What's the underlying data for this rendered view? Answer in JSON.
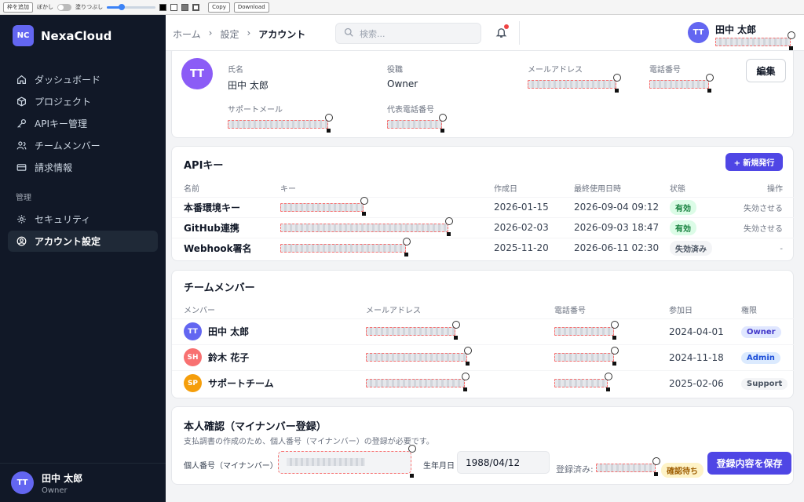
{
  "toolbar": {
    "add_frame": "枠を追加",
    "blur": "ぼかし",
    "fill": "塗りつぶし",
    "copy": "Copy",
    "download": "Download",
    "slider_level": 0.3
  },
  "brand": {
    "logo": "NC",
    "name": "NexaCloud"
  },
  "nav": {
    "items": [
      {
        "label": "ダッシュボード",
        "icon": "home-icon"
      },
      {
        "label": "プロジェクト",
        "icon": "cube-icon"
      },
      {
        "label": "APIキー管理",
        "icon": "key-icon"
      },
      {
        "label": "チームメンバー",
        "icon": "users-icon"
      },
      {
        "label": "請求情報",
        "icon": "card-icon"
      }
    ],
    "section": "管理",
    "admin_items": [
      {
        "label": "セキュリティ",
        "icon": "gear-icon"
      },
      {
        "label": "アカウント設定",
        "icon": "user-circle-icon"
      }
    ]
  },
  "user": {
    "initials": "TT",
    "name": "田中 太郎",
    "role": "Owner"
  },
  "header": {
    "breadcrumbs": [
      "ホーム",
      "設定",
      "アカウント"
    ],
    "search_placeholder": "検索..."
  },
  "profile": {
    "name_label": "氏名",
    "name": "田中 太郎",
    "role_label": "役職",
    "role": "Owner",
    "email_label": "メールアドレス",
    "phone_label": "電話番号",
    "support_email_label": "サポートメール",
    "rep_phone_label": "代表電話番号",
    "edit": "編集"
  },
  "api": {
    "title": "APIキー",
    "new_button": "+ 新規発行",
    "headers": [
      "名前",
      "キー",
      "作成日",
      "最終使用日時",
      "状態",
      "操作"
    ],
    "rows": [
      {
        "name": "本番環境キー",
        "created": "2026-01-15",
        "last_used": "2026-09-04 09:12",
        "status": "有効",
        "action": "失効させる"
      },
      {
        "name": "GitHub連携",
        "created": "2026-02-03",
        "last_used": "2026-09-03 18:47",
        "status": "有効",
        "action": "失効させる"
      },
      {
        "name": "Webhook署名",
        "created": "2025-11-20",
        "last_used": "2026-06-11 02:30",
        "status": "失効済み",
        "action": "-"
      }
    ]
  },
  "team": {
    "title": "チームメンバー",
    "headers": [
      "メンバー",
      "メールアドレス",
      "電話番号",
      "参加日",
      "権限"
    ],
    "rows": [
      {
        "initials": "TT",
        "name": "田中 太郎",
        "joined": "2024-04-01",
        "role": "Owner",
        "color": "#6366f1"
      },
      {
        "initials": "SH",
        "name": "鈴木 花子",
        "joined": "2024-11-18",
        "role": "Admin",
        "color": "#f87171"
      },
      {
        "initials": "SP",
        "name": "サポートチーム",
        "joined": "2025-02-06",
        "role": "Support",
        "color": "#f59e0b"
      }
    ]
  },
  "identity": {
    "title": "本人確認（マイナンバー登録）",
    "desc": "支払調書の作成のため、個人番号（マイナンバー）の登録が必要です。",
    "number_label": "個人番号（マイナンバー）",
    "dob_label": "生年月日",
    "dob": "1988/04/12",
    "registered_label": "登録済み:",
    "status": "確認待ち",
    "save": "登録内容を保存"
  }
}
